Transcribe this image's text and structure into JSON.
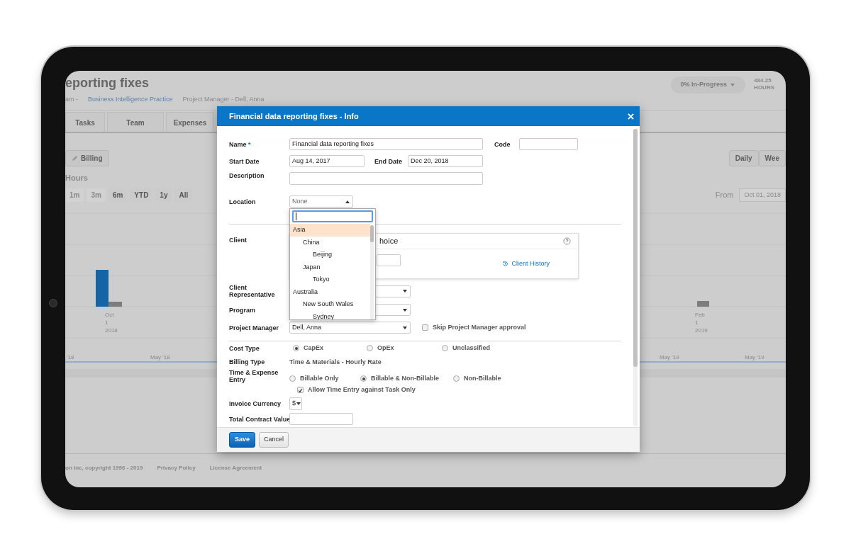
{
  "background_app": {
    "title": "eporting fixes",
    "breadcrumb": [
      {
        "text": "am -",
        "kind": "text"
      },
      {
        "text": "Business Intelligence Practice",
        "kind": "link"
      },
      {
        "text": "Project Manager - Dell, Anna",
        "kind": "text"
      }
    ],
    "status": {
      "percent": "0%",
      "state": "In-Progress"
    },
    "hours": {
      "value": "484.25",
      "unit": "HOURS"
    },
    "tabs": [
      "Tasks",
      "Team",
      "Expenses"
    ],
    "billing_button": "Billing",
    "view_buttons": [
      "Daily",
      "Wee"
    ],
    "hours_label": "Hours",
    "ranges": [
      {
        "label": "1m",
        "disabled": true
      },
      {
        "label": "3m",
        "disabled": true
      },
      {
        "label": "6m",
        "disabled": false
      },
      {
        "label": "YTD",
        "disabled": false
      },
      {
        "label": "1y",
        "disabled": false
      },
      {
        "label": "All",
        "disabled": false
      }
    ],
    "from_label": "From",
    "from_date": "Oct 01, 2018",
    "chart": {
      "bar_labels": [
        [
          "Oct",
          "1",
          "2018"
        ],
        [
          "Feb",
          "1",
          "2019"
        ]
      ],
      "axis_labels": [
        "'18",
        "May '18",
        "May '19",
        "May '19"
      ]
    },
    "footer": [
      "on Inc, copyright 1996 - 2019",
      "Privacy Policy",
      "License Agreement"
    ]
  },
  "modal": {
    "title": "Financial data reporting fixes - Info",
    "name": {
      "label": "Name",
      "required_mark": "*",
      "value": "Financial data reporting fixes"
    },
    "code": {
      "label": "Code"
    },
    "start_date": {
      "label": "Start Date",
      "value": "Aug 14, 2017"
    },
    "end_date": {
      "label": "End Date",
      "value": "Dec 20, 2018"
    },
    "description": {
      "label": "Description"
    },
    "location": {
      "label": "Location",
      "value": "None",
      "expanded": true,
      "options": [
        {
          "label": "Asia",
          "selected": true,
          "children": [
            {
              "label": "China",
              "selected": false,
              "children": [
                {
                  "label": "Beijing",
                  "selected": false
                }
              ]
            },
            {
              "label": "Japan",
              "selected": false,
              "children": [
                {
                  "label": "Tokyo",
                  "selected": false
                }
              ]
            }
          ]
        },
        {
          "label": "Australia",
          "selected": false,
          "children": [
            {
              "label": "New South Wales",
              "selected": false,
              "children": [
                {
                  "label": "Sydney",
                  "selected": false
                }
              ]
            }
          ]
        }
      ]
    },
    "client": {
      "label": "Client",
      "hint": "hoice",
      "history_link": "Client History"
    },
    "client_representative": {
      "label": "Client Representative"
    },
    "program": {
      "label": "Program"
    },
    "project_manager": {
      "label": "Project Manager",
      "value": "Dell, Anna"
    },
    "skip_approval": {
      "label": "Skip Project Manager approval",
      "checked": false
    },
    "cost_type": {
      "label": "Cost Type",
      "options": [
        {
          "label": "CapEx",
          "selected": true
        },
        {
          "label": "OpEx",
          "selected": false
        },
        {
          "label": "Unclassified",
          "selected": false
        }
      ]
    },
    "billing_type": {
      "label": "Billing Type",
      "value": "Time & Materials - Hourly Rate"
    },
    "time_expense_entry": {
      "label": "Time & Expense Entry",
      "options": [
        {
          "label": "Billable Only",
          "selected": false
        },
        {
          "label": "Billable & Non-Billable",
          "selected": true
        },
        {
          "label": "Non-Billable",
          "selected": false
        }
      ]
    },
    "task_only": {
      "label": "Allow Time Entry against Task Only",
      "checked": true
    },
    "invoice_currency": {
      "label": "Invoice Currency",
      "value": "$"
    },
    "total_contract_value": {
      "label": "Total Contract Value"
    },
    "buttons": [
      {
        "label": "Save",
        "kind": "primary"
      },
      {
        "label": "Cancel",
        "kind": "secondary"
      }
    ]
  }
}
